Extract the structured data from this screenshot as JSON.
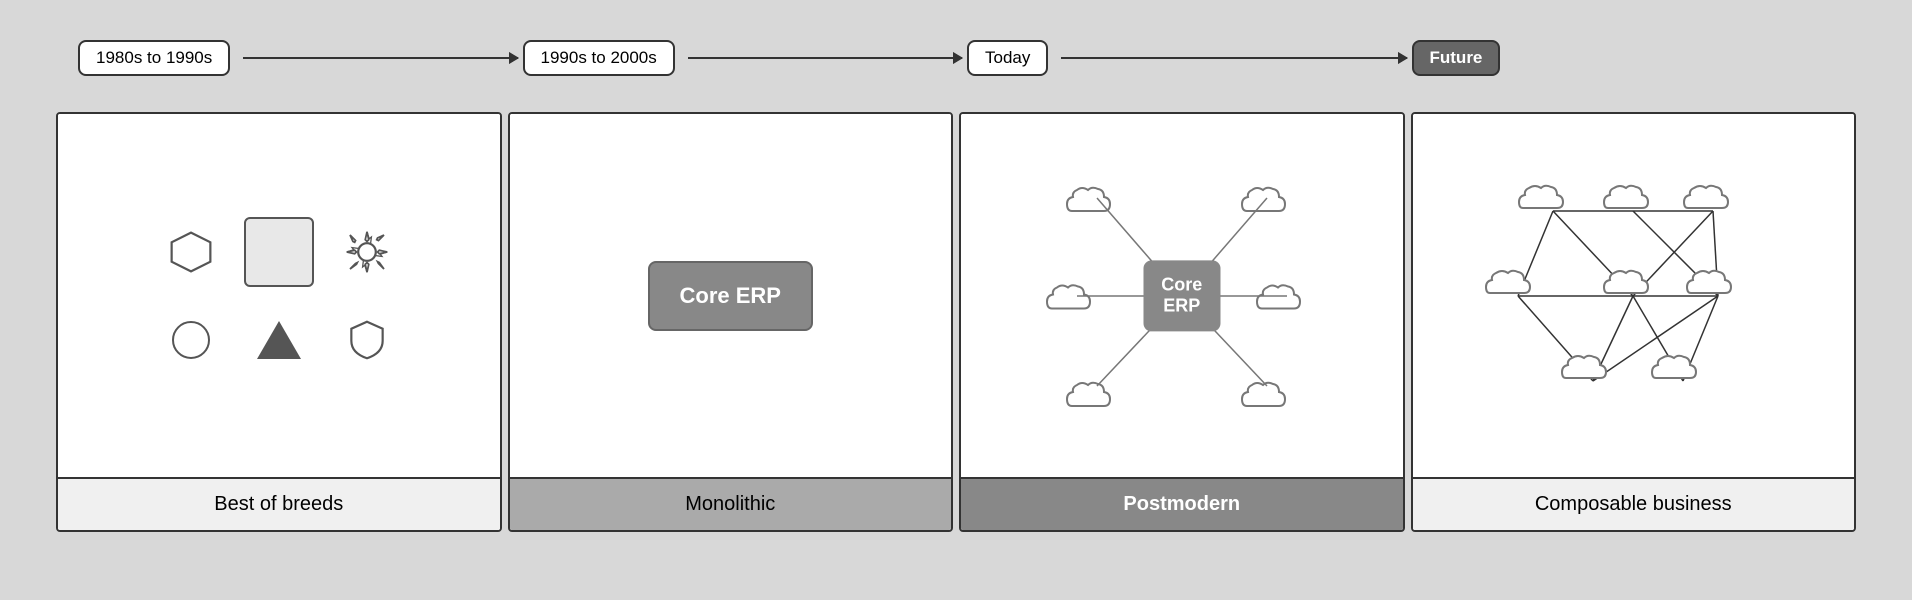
{
  "diagram": {
    "background_color": "#d8d8d8",
    "eras": [
      {
        "id": "era1",
        "label": "1980s to 1990s",
        "is_future": false
      },
      {
        "id": "era2",
        "label": "1990s to 2000s",
        "is_future": false
      },
      {
        "id": "era3",
        "label": "Today",
        "is_future": false
      },
      {
        "id": "era4",
        "label": "Future",
        "is_future": true
      }
    ],
    "cards": [
      {
        "id": "card1",
        "title": "Best of breeds",
        "title_style": "light",
        "content_type": "shapes"
      },
      {
        "id": "card2",
        "title": "Monolithic",
        "title_style": "medium",
        "content_type": "core_erp"
      },
      {
        "id": "card3",
        "title": "Postmodern",
        "title_style": "dark",
        "content_type": "postmodern"
      },
      {
        "id": "card4",
        "title": "Composable business",
        "title_style": "light",
        "content_type": "composable"
      }
    ],
    "core_erp_label": "Core ERP",
    "center_erp_line1": "Core",
    "center_erp_line2": "ERP"
  }
}
